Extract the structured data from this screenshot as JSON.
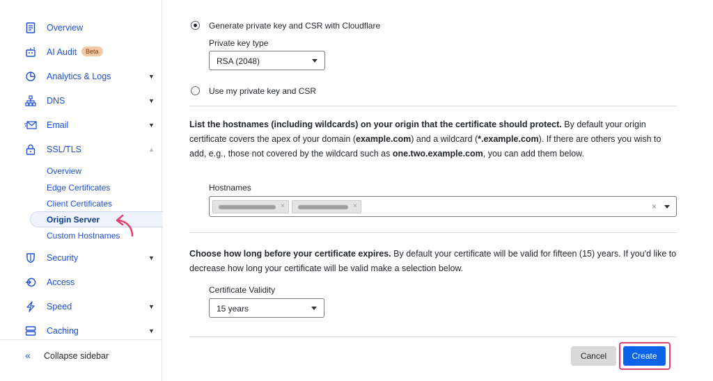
{
  "sidebar": {
    "items": [
      {
        "label": "Overview",
        "icon": "document-icon"
      },
      {
        "label": "AI Audit",
        "icon": "robot-icon",
        "badge": "Beta"
      },
      {
        "label": "Analytics & Logs",
        "icon": "pie-chart-icon"
      },
      {
        "label": "DNS",
        "icon": "network-icon"
      },
      {
        "label": "Email",
        "icon": "email-icon"
      },
      {
        "label": "SSL/TLS",
        "icon": "lock-icon"
      },
      {
        "label": "Security",
        "icon": "shield-icon"
      },
      {
        "label": "Access",
        "icon": "access-icon"
      },
      {
        "label": "Speed",
        "icon": "lightning-icon"
      },
      {
        "label": "Caching",
        "icon": "server-icon"
      }
    ],
    "ssl_subitems": [
      "Overview",
      "Edge Certificates",
      "Client Certificates",
      "Origin Server",
      "Custom Hostnames"
    ],
    "active_subitem": "Origin Server",
    "collapse_label": "Collapse sidebar"
  },
  "main": {
    "radio_generate": "Generate private key and CSR with Cloudflare",
    "key_type_label": "Private key type",
    "key_type_value": "RSA (2048)",
    "radio_own": "Use my private key and CSR",
    "hostnames_para": {
      "bold": "List the hostnames (including wildcards) on your origin that the certificate should protect.",
      "t1": " By default your origin certificate covers the apex of your domain (",
      "b1": "example.com",
      "t2": ") and a wildcard (",
      "b2": "*.example.com",
      "t3": "). If there are others you wish to add, e.g., those not covered by the wildcard such as ",
      "b3": "one.two.example.com",
      "t4": ", you can add them below."
    },
    "hostnames_label": "Hostnames",
    "hostname_clear": "×",
    "chip_remove": "×",
    "validity_para": {
      "bold": "Choose how long before your certificate expires.",
      "text": " By default your certificate will be valid for fifteen (15) years. If you'd like to decrease how long your certificate will be valid make a selection below."
    },
    "validity_label": "Certificate Validity",
    "validity_value": "15 years",
    "cancel_label": "Cancel",
    "create_label": "Create"
  },
  "colors": {
    "accent": "#0a63e8",
    "link": "#1d4ed8",
    "highlight": "#e2426b",
    "beta_badge": "#f6c7a7"
  }
}
